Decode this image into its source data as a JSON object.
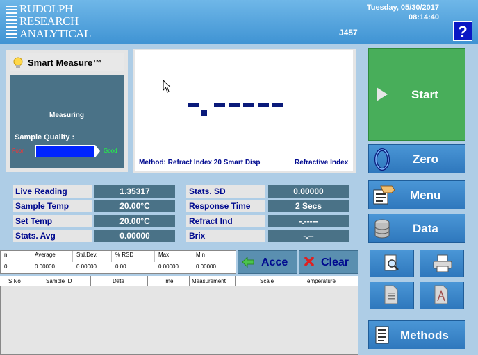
{
  "header": {
    "logo_lines": [
      "RUDOLPH",
      "RESEARCH",
      "ANALYTICAL"
    ],
    "date": "Tuesday, 05/30/2017",
    "time": "08:14:40",
    "instrument_id": "J457",
    "help_label": "?"
  },
  "smart_measure": {
    "title": "Smart Measure™",
    "status": "Measuring",
    "sample_quality_label": "Sample Quality :",
    "poor_label": "Poor",
    "good_label": "Good",
    "quality_level": 1.0
  },
  "display": {
    "method": "Method: Refract Index 20 Smart Disp",
    "scale": "Refractive Index"
  },
  "readings": {
    "live_reading_label": "Live Reading",
    "live_reading_value": "1.35317",
    "sample_temp_label": "Sample Temp",
    "sample_temp_value": "20.00°C",
    "set_temp_label": "Set Temp",
    "set_temp_value": "20.00°C",
    "stats_avg_label": "Stats. Avg",
    "stats_avg_value": "0.00000",
    "stats_sd_label": "Stats. SD",
    "stats_sd_value": "0.00000",
    "response_time_label": "Response Time",
    "response_time_value": "2 Secs",
    "refract_ind_label": "Refract Ind",
    "refract_ind_value": "-.-----",
    "brix_label": "Brix",
    "brix_value": "-.--"
  },
  "stats_table": {
    "headers": [
      "n",
      "Average",
      "Std.Dev.",
      "% RSD",
      "Max",
      "Min"
    ],
    "row": [
      "0",
      "0.00000",
      "0.00000",
      "0.00",
      "0.00000",
      "0.00000"
    ]
  },
  "actions": {
    "accept_label": "Acce",
    "clear_label": "Clear"
  },
  "results_table": {
    "headers": [
      "S.No",
      "Sample ID",
      "Date",
      "Time",
      "Measurement",
      "Scale",
      "Temperature"
    ]
  },
  "side_buttons": {
    "start_label": "Start",
    "zero_label": "Zero",
    "menu_label": "Menu",
    "data_label": "Data",
    "methods_label": "Methods"
  },
  "colors": {
    "header_blue": "#3f93d3",
    "start_green": "#48ae5a",
    "panel_slate": "#4a7287",
    "label_navy": "#000a8f",
    "quality_bar": "#0024ff"
  }
}
